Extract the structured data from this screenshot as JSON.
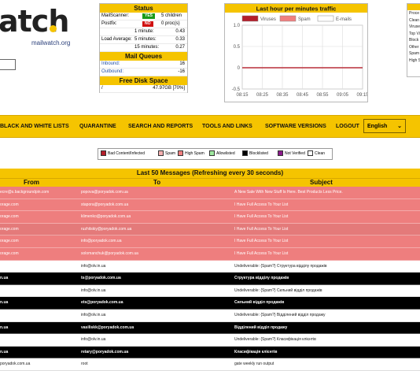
{
  "logo": {
    "text": "atch",
    "subtitle": "mailwatch.org"
  },
  "status": {
    "title": "Status",
    "rows": [
      {
        "key": "MailScanner:",
        "badge": "YES",
        "badge_color": "#1a9a1a",
        "value": "5 children"
      },
      {
        "key": "Postfix:",
        "badge": "NO",
        "badge_color": "#d01010",
        "value": "0 proc(s)"
      }
    ],
    "load_label": "Load Average:",
    "load": [
      {
        "period": "1 minute:",
        "value": "0.43"
      },
      {
        "period": "5 minutes:",
        "value": "0.33"
      },
      {
        "period": "15 minutes:",
        "value": "0.27"
      }
    ],
    "queues_title": "Mail Queues",
    "queues": [
      {
        "name": "Inbound:",
        "value": "16"
      },
      {
        "name": "Outbound:",
        "value": "-16"
      }
    ],
    "disk_title": "Free Disk Space",
    "disk": {
      "mount": "/",
      "value": "47.97GB [70%]"
    }
  },
  "traffic": {
    "title": "Last hour per minutes traffic",
    "legend": [
      {
        "name": "Viruses",
        "color": "#b41e2a"
      },
      {
        "name": "Spam",
        "color": "#f07f7f"
      },
      {
        "name": "E-mails",
        "color": "#ffffff"
      }
    ]
  },
  "chart_data": {
    "type": "line",
    "title": "Last hour per minutes traffic",
    "x": [
      "08:15",
      "08:25",
      "08:35",
      "08:45",
      "08:55",
      "09:05",
      "09:15"
    ],
    "yticks": [
      "1.0",
      "0.5",
      "0",
      "-0.5"
    ],
    "ylim": [
      -0.5,
      1.0
    ],
    "series": [
      {
        "name": "Viruses",
        "color": "#b41e2a",
        "values": [
          0,
          0,
          0,
          0,
          0,
          0,
          0
        ]
      },
      {
        "name": "Spam",
        "color": "#f07f7f",
        "values": [
          0,
          0,
          0,
          0,
          0,
          0,
          0
        ]
      },
      {
        "name": "E-mails",
        "color": "#ffffff",
        "values": [
          0,
          0,
          0,
          0,
          0,
          0,
          0
        ]
      }
    ],
    "grid": true
  },
  "right_panel": {
    "items": [
      "Proce",
      "Clean",
      "Viruse",
      "Top Vi",
      "Block",
      "Other",
      "Spam",
      "High S"
    ]
  },
  "nav": {
    "items": [
      "BLACK AND WHITE LISTS",
      "QUARANTINE",
      "SEARCH AND REPORTS",
      "TOOLS AND LINKS",
      "SOFTWARE VERSIONS",
      "LOGOUT"
    ],
    "language": "English"
  },
  "legend": [
    {
      "label": "Bad Content/Infected",
      "color": "#b41e2a"
    },
    {
      "label": "Spam",
      "color": "#f4b0b0"
    },
    {
      "label": "High Spam",
      "color": "#f07f7f"
    },
    {
      "label": "Allowlisted",
      "color": "#9fe89f"
    },
    {
      "label": "Blocklisted",
      "color": "#000000"
    },
    {
      "label": "Not Verified",
      "color": "#8b1a8b"
    },
    {
      "label": "Clean",
      "color": "#ffffff"
    }
  ],
  "messages": {
    "title": "Last 50 Messages (Refreshing every 30 seconds)",
    "columns": [
      "From",
      "To",
      "Subject"
    ],
    "rows": [
      {
        "from": "ecre@s.backgroundpin.com",
        "to": "popova@poryadok.com.ua",
        "subject": "A New Sale With New Stuff Is Here. Best Products Less Price.",
        "style": "highspam"
      },
      {
        "from": "orage.com",
        "to": "stapora@poryadok.com.ua",
        "subject": "I Have Full Access To Your List",
        "style": "highspam"
      },
      {
        "from": "orage.com",
        "to": "klimenko@poryadok.com.ua",
        "subject": "I Have Full Access To Your List",
        "style": "highspam"
      },
      {
        "from": "orage.com",
        "to": "ruzhitskiy@poryadok.com.ua",
        "subject": "I Have Full Access To Your List",
        "style": "highspam2"
      },
      {
        "from": "orage.com",
        "to": "info@poryadok.com.ua",
        "subject": "I Have Full Access To Your List",
        "style": "highspam"
      },
      {
        "from": "orage.com",
        "to": "solomanchuk@poryadok.com.ua",
        "subject": "I Have Full Access To Your List",
        "style": "highspam"
      },
      {
        "from": "",
        "to": "info@olv.in.ua",
        "subject": "Undeliverable: {Spam?} Структура відділу продажів",
        "style": "clean"
      },
      {
        "from": "n.ua",
        "to": "ts@poryadok.com.ua",
        "subject": "Структура відділу продажів",
        "style": "block"
      },
      {
        "from": "",
        "to": "info@olv.in.ua",
        "subject": "Undeliverable: {Spam?} Сильний відділ продажів",
        "style": "clean"
      },
      {
        "from": "n.ua",
        "to": "ets@poryadok.com.ua",
        "subject": "Сильний відділ продажів",
        "style": "block"
      },
      {
        "from": "",
        "to": "info@olv.in.ua",
        "subject": "Undeliverable: {Spam?} Відділений відділ продажу",
        "style": "clean"
      },
      {
        "from": "n.ua",
        "to": "vasiliskk@poryadok.com.ua",
        "subject": "Відділений відділ продажу",
        "style": "block"
      },
      {
        "from": "",
        "to": "info@olv.in.ua",
        "subject": "Undeliverable: {Spam?} Класифікація клієнтів",
        "style": "clean"
      },
      {
        "from": "n.ua",
        "to": "retary@poryadok.com.ua",
        "subject": "Класифікація клієнтів",
        "style": "block"
      },
      {
        "from": "poryadok.com.ua",
        "to": "root",
        "subject": "gate weekly run output",
        "style": "clean"
      }
    ]
  }
}
